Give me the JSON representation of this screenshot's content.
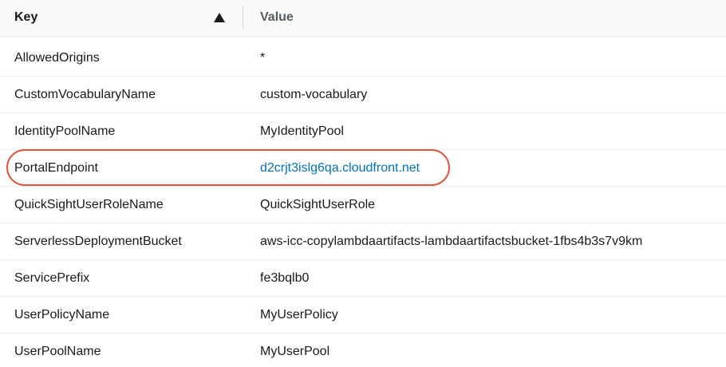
{
  "header": {
    "key_label": "Key",
    "value_label": "Value",
    "sort_icon": "triangle-up-icon"
  },
  "rows": [
    {
      "key": "AllowedOrigins",
      "value": "*"
    },
    {
      "key": "CustomVocabularyName",
      "value": "custom-vocabulary"
    },
    {
      "key": "IdentityPoolName",
      "value": "MyIdentityPool"
    },
    {
      "key": "PortalEndpoint",
      "value": "d2crjt3islg6qa.cloudfront.net",
      "is_link": true
    },
    {
      "key": "QuickSightUserRoleName",
      "value": "QuickSightUserRole"
    },
    {
      "key": "ServerlessDeploymentBucket",
      "value": "aws-icc-copylambdaartifacts-lambdaartifactsbucket-1fbs4b3s7v9km"
    },
    {
      "key": "ServicePrefix",
      "value": "fe3bqlb0"
    },
    {
      "key": "UserPolicyName",
      "value": "MyUserPolicy"
    },
    {
      "key": "UserPoolName",
      "value": "MyUserPool"
    }
  ],
  "colors": {
    "link": "#0073bb",
    "highlight": "#e0533d"
  }
}
